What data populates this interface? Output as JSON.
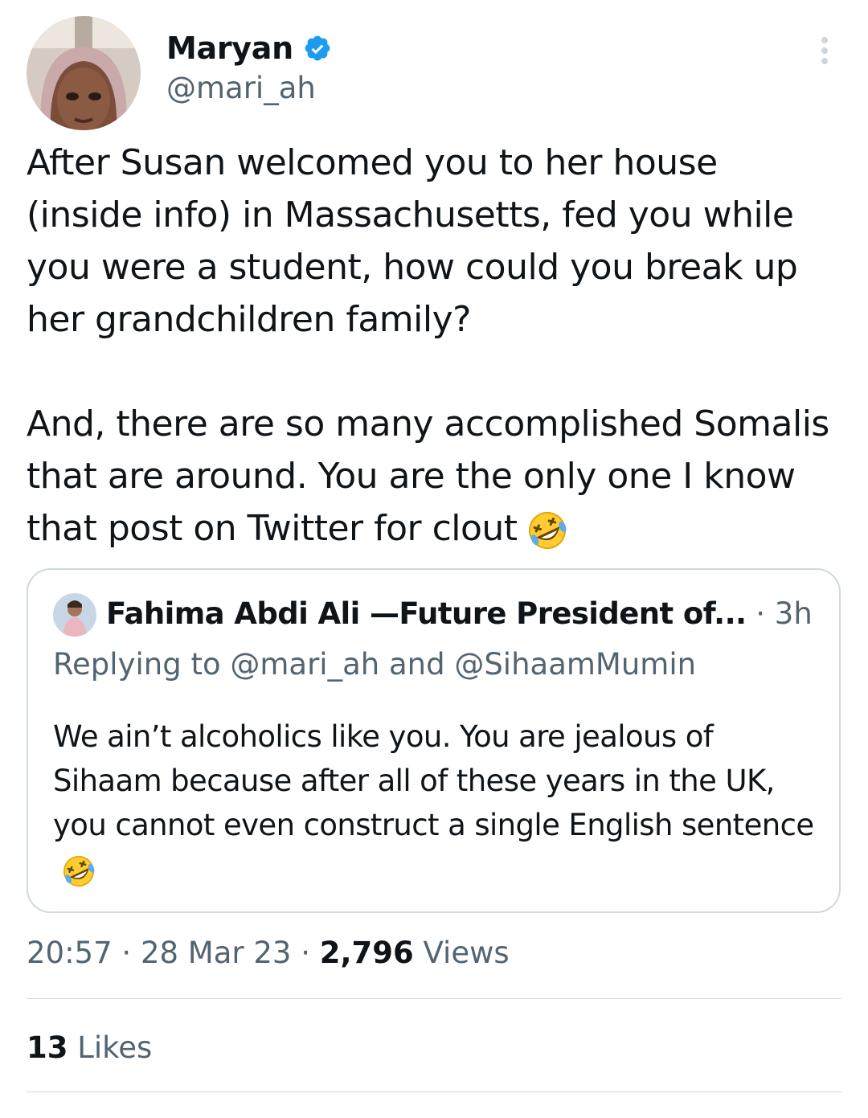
{
  "tweet": {
    "author": {
      "name": "Maryan",
      "handle": "@mari_ah",
      "verified": true,
      "avatar_icon": "user-avatar"
    },
    "more_icon": "more-vertical-icon",
    "paragraphs": [
      "After Susan welcomed you to her house (inside info) in Massachusetts, fed you while you were a student, how could you break up her grandchildren family?",
      "And, there are so many accomplished Somalis that are around. You are the only one I know that post on Twitter for clout"
    ],
    "emoji": "rolling-on-floor-laughing-emoji",
    "quoted": {
      "author_name": "Fahima Abdi Ali —Future President of...",
      "separator": " · ",
      "time": "3h",
      "replying_to": "Replying to @mari_ah and @SihaamMumin",
      "text": "We ain’t alcoholics like you. You are jealous of Sihaam because after all of these years in the UK, you cannot even construct a single English sentence",
      "emoji": "rolling-on-floor-laughing-emoji"
    },
    "meta": {
      "time": "20:57",
      "separator": " · ",
      "date": "28 Mar 23",
      "views_count": "2,796",
      "views_label": " Views"
    },
    "likes": {
      "count": "13",
      "label": " Likes"
    }
  },
  "colors": {
    "text_primary": "#0f1419",
    "text_secondary": "#536471",
    "border": "#cfd9de",
    "verified_blue": "#1d9bf0"
  }
}
